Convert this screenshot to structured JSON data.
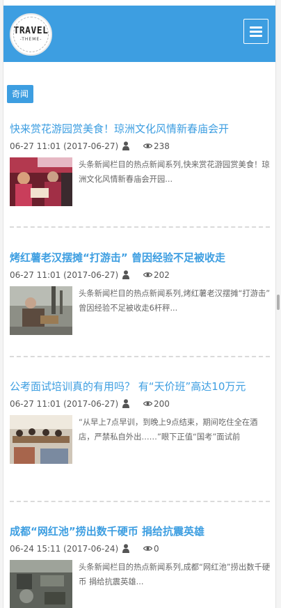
{
  "header": {
    "logo_top": "TRAVEL",
    "logo_bottom": "-THEME-",
    "background_color": "#3d9ee1"
  },
  "category": {
    "label": "奇闻"
  },
  "articles": [
    {
      "title": "快来赏花游园赏美食！琼洲文化风情新春庙会开",
      "date": "06-27 11:01 (2017-06-27)",
      "views": "238",
      "summary": "头条新闻栏目的热点新闻系列,快来赏花游园赏美食！琼洲文化风情新春庙会开园...",
      "bold": false
    },
    {
      "title": "烤红薯老汉摆摊“打游击” 曾因经验不足被收走",
      "date": "06-27 11:01 (2017-06-27)",
      "views": "202",
      "summary": "头条新闻栏目的热点新闻系列,烤红薯老汉摆摊“打游击” 曾因经验不足被收走6杆秤...",
      "bold": true
    },
    {
      "title": "公考面试培训真的有用吗？ 有“天价班”高达10万元",
      "date": "06-27 11:01 (2017-06-27)",
      "views": "200",
      "summary": "“从早上7点早训，到晚上9点结束，期间吃住全在酒店，严禁私自外出……”眼下正值“国考”面试前",
      "bold": false
    },
    {
      "title": "成都“网红池”捞出数千硬币 捐给抗震英雄",
      "date": "06-24 15:11 (2017-06-24)",
      "views": "0",
      "summary": "头条新闻栏目的热点新闻系列,成都“网红池”捞出数千硬币 捐给抗震英雄...",
      "bold": true
    }
  ],
  "icons": {
    "author": "user-icon",
    "views": "eye-icon",
    "menu": "hamburger-icon"
  }
}
